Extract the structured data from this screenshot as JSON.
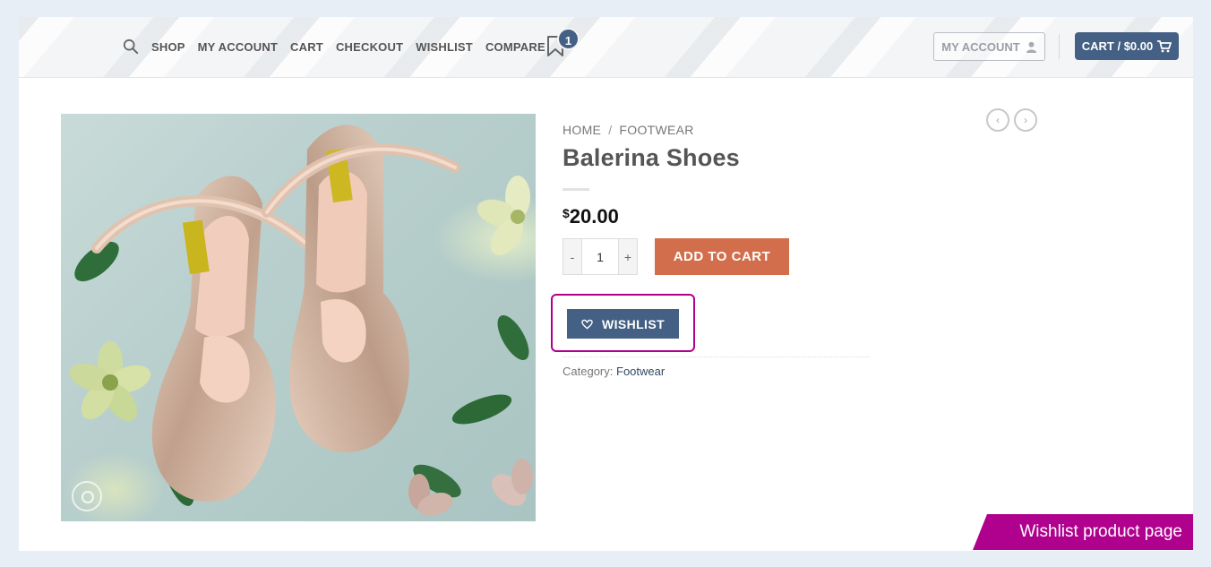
{
  "header": {
    "nav": [
      "SHOP",
      "MY ACCOUNT",
      "CART",
      "CHECKOUT",
      "WISHLIST",
      "COMPARE"
    ],
    "wishlist_count": "1",
    "account_label": "MY ACCOUNT",
    "cart_label": "CART / $0.00"
  },
  "breadcrumb": {
    "home": "HOME",
    "separator": "/",
    "category": "FOOTWEAR"
  },
  "product": {
    "title": "Balerina Shoes",
    "currency": "$",
    "price": "20.00",
    "quantity": "1",
    "qty_minus": "-",
    "qty_plus": "+",
    "add_to_cart": "ADD TO CART",
    "wishlist_label": "WISHLIST",
    "category_label": "Category:",
    "category_value": "Footwear"
  },
  "product_nav": {
    "prev": "‹",
    "next": "›"
  },
  "banner": {
    "text": "Wishlist product page"
  },
  "colors": {
    "primary": "#446084",
    "accent": "#d26e4b",
    "highlight": "#b0008e"
  },
  "icons": [
    "search-icon",
    "bookmark-icon",
    "user-icon",
    "cart-icon",
    "heart-icon",
    "zoom-icon",
    "chevron-left-icon",
    "chevron-right-icon"
  ]
}
